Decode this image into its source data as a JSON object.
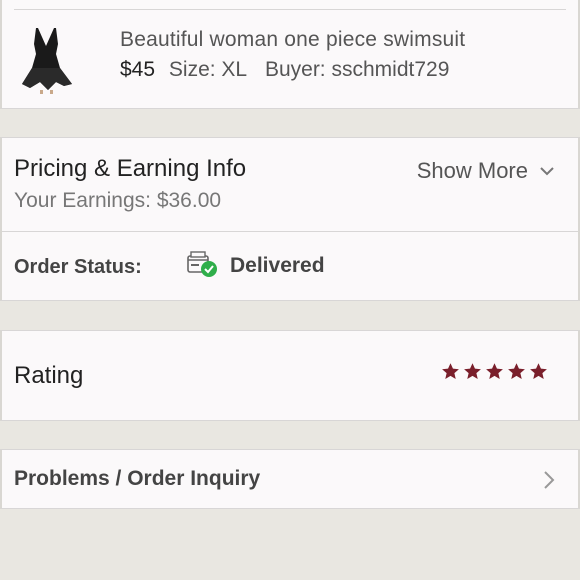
{
  "product": {
    "title": "Beautiful woman one piece swimsuit",
    "price": "$45",
    "size_label": "Size: XL",
    "buyer_label": "Buyer: sschmidt729"
  },
  "pricing": {
    "title": "Pricing & Earning Info",
    "earnings": "Your Earnings: $36.00",
    "show_more": "Show More",
    "show_more_icon": "chevron-down-icon"
  },
  "order_status": {
    "label": "Order Status:",
    "value": "Delivered",
    "icon": "package-delivered-icon",
    "check_color": "#2fae4a"
  },
  "rating": {
    "label": "Rating",
    "stars": 5,
    "max_stars": 5,
    "star_color": "#7a1f2b"
  },
  "problems": {
    "label": "Problems / Order Inquiry",
    "icon": "chevron-right-icon"
  }
}
